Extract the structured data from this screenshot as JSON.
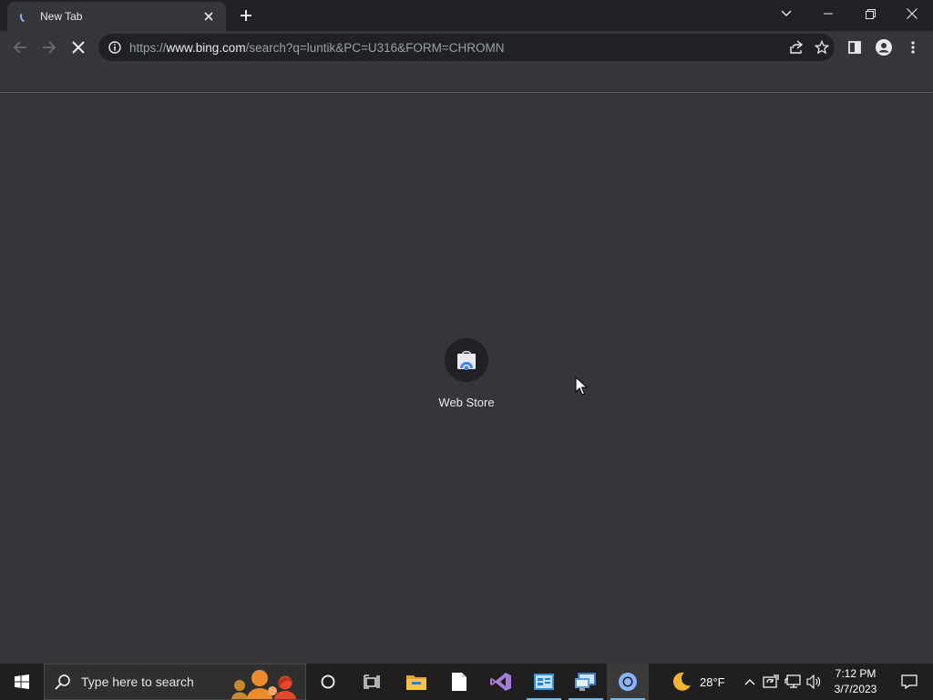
{
  "browser": {
    "tab": {
      "title": "New Tab"
    },
    "omnibox": {
      "url_prefix": "https://",
      "url_host": "www.bing.com",
      "url_path": "/search?q=luntik&PC=U316&FORM=CHROMN"
    }
  },
  "newtab": {
    "shortcuts": [
      {
        "label": "Web Store",
        "icon": "chrome-web-store-icon"
      }
    ]
  },
  "taskbar": {
    "search_placeholder": "Type here to search",
    "pinned_apps": [
      {
        "name": "cortana",
        "icon": "cortana-circle-icon"
      },
      {
        "name": "task-view",
        "icon": "task-view-icon"
      },
      {
        "name": "file-explorer",
        "icon": "folder-icon"
      },
      {
        "name": "notepad",
        "icon": "document-icon"
      },
      {
        "name": "visual-studio",
        "icon": "visual-studio-icon"
      },
      {
        "name": "control-panel",
        "icon": "control-panel-icon"
      },
      {
        "name": "remote-desktop",
        "icon": "remote-desktop-icon"
      },
      {
        "name": "chrome",
        "icon": "chrome-icon"
      }
    ],
    "weather": {
      "temp": "28°F",
      "icon": "moon-icon"
    },
    "clock": {
      "time": "7:12 PM",
      "date": "3/7/2023"
    }
  },
  "colors": {
    "tabstrip": "#202124",
    "toolbar": "#35363a",
    "page_bg": "#35363a",
    "omnibox_bg": "#202124",
    "text_primary": "#e8eaed",
    "text_secondary": "#9aa0a6",
    "taskbar": "#1f1f1f",
    "accent_blue": "#8ab4f8"
  }
}
